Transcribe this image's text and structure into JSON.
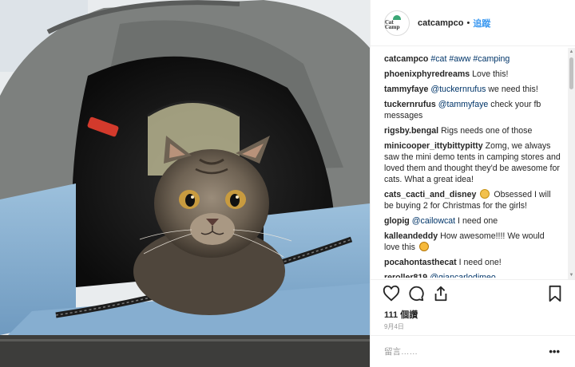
{
  "post": {
    "author": "catcampco",
    "avatar_text": "Cat Camp",
    "separator": "•",
    "follow_label": "追蹤"
  },
  "comments": [
    {
      "user": "catcampco",
      "parts": [
        {
          "t": "#cat",
          "link": true
        },
        {
          "t": " "
        },
        {
          "t": "#aww",
          "link": true
        },
        {
          "t": " "
        },
        {
          "t": "#camping",
          "link": true
        }
      ]
    },
    {
      "user": "phoenixphyredreams",
      "parts": [
        {
          "t": "Love this!"
        }
      ]
    },
    {
      "user": "tammyfaye",
      "parts": [
        {
          "t": "@tuckernrufus",
          "link": true
        },
        {
          "t": " we need this!"
        }
      ]
    },
    {
      "user": "tuckernrufus",
      "parts": [
        {
          "t": "@tammyfaye",
          "link": true
        },
        {
          "t": " check your fb messages"
        }
      ]
    },
    {
      "user": "rigsby.bengal",
      "parts": [
        {
          "t": "Rigs needs one of those"
        }
      ]
    },
    {
      "user": "minicooper_ittybittypitty",
      "parts": [
        {
          "t": "Zomg, we always saw the mini demo tents in camping stores and loved them and thought they'd be awesome for cats. What a great idea!"
        }
      ]
    },
    {
      "user": "cats_cacti_and_disney",
      "parts": [
        {
          "emoji": "hands"
        },
        {
          "t": " Obsessed I will be buying 2 for Christmas for the girls!"
        }
      ]
    },
    {
      "user": "glopig",
      "parts": [
        {
          "t": "@cailowcat",
          "link": true
        },
        {
          "t": " I need one"
        }
      ]
    },
    {
      "user": "kalleandeddy",
      "parts": [
        {
          "t": "How awesome!!!! We would love this "
        },
        {
          "emoji": "cat"
        }
      ]
    },
    {
      "user": "pocahontasthecat",
      "parts": [
        {
          "t": "I need one!"
        }
      ]
    },
    {
      "user": "reroller819",
      "parts": [
        {
          "t": "@giancarlodimeo",
          "link": true
        }
      ]
    }
  ],
  "actions": {
    "icons": [
      "heart-icon",
      "comment-icon",
      "share-icon",
      "bookmark-icon"
    ]
  },
  "likes_text": "111 個讚",
  "date_text": "9月4日",
  "comment_placeholder": "留言……",
  "more_text": "•••",
  "scroll_up": "▲",
  "scroll_down": "▼",
  "colors": {
    "link": "#003569",
    "follow": "#3897f0",
    "tent_blue": "#8fb6d6",
    "tent_grey": "#7f817f",
    "avatar_tent": "#3ba776"
  }
}
